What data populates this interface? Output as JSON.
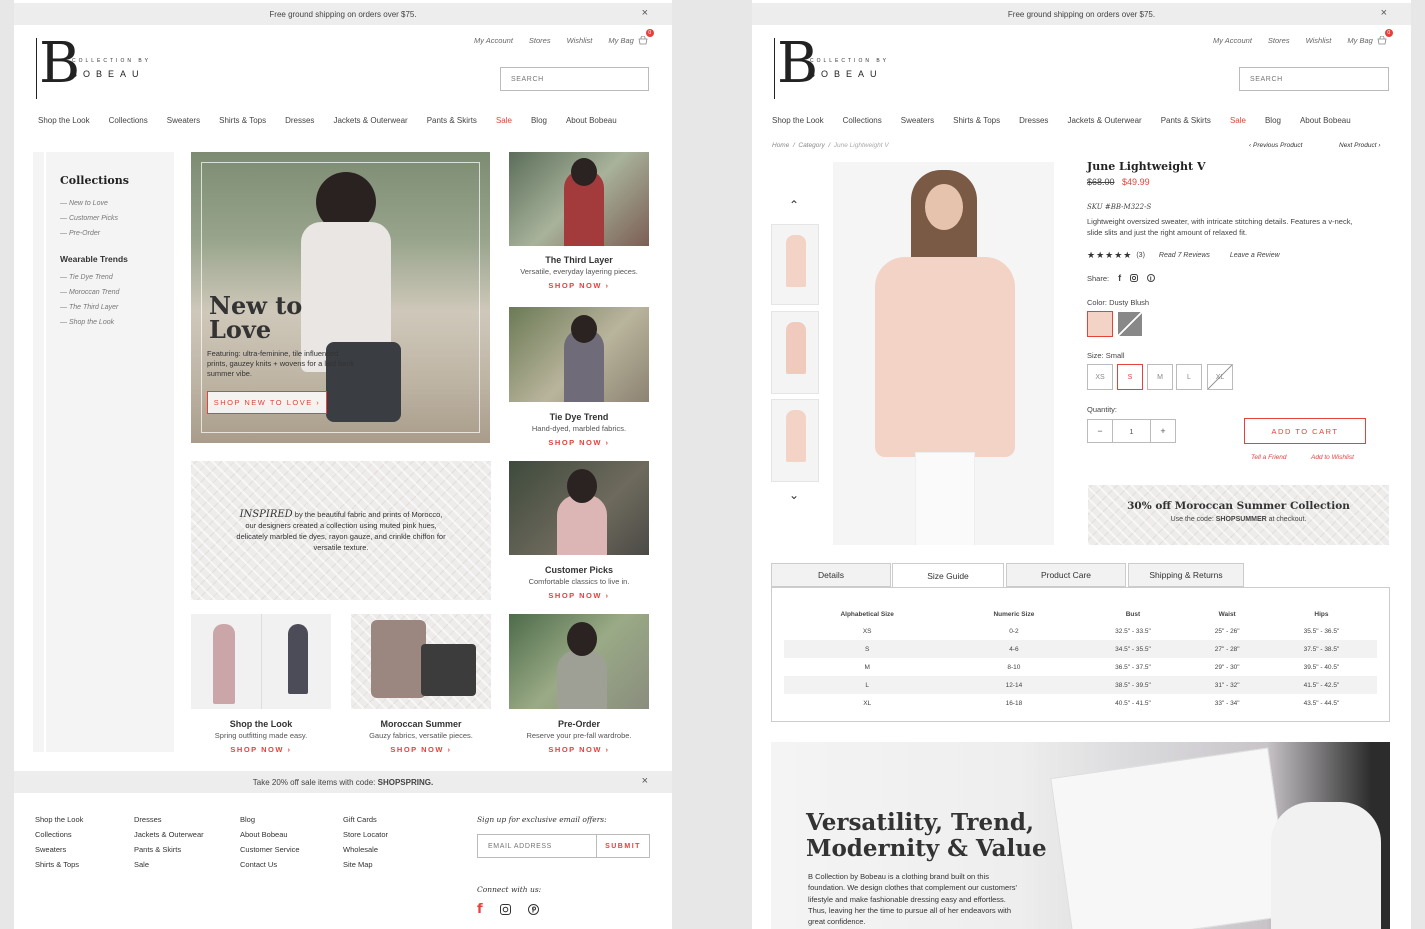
{
  "promo": {
    "text": "Free ground shipping on orders over $75.",
    "close": "×"
  },
  "util": {
    "account": "My Account",
    "stores": "Stores",
    "wishlist": "Wishlist",
    "bag": "My Bag",
    "bag_count": "0"
  },
  "search": {
    "placeholder": "SEARCH"
  },
  "logo": {
    "letter": "B",
    "sub": "COLLECTION BY",
    "brand": "BOBEAU"
  },
  "nav": [
    "Shop the Look",
    "Collections",
    "Sweaters",
    "Shirts & Tops",
    "Dresses",
    "Jackets & Outerwear",
    "Pants & Skirts",
    "Sale",
    "Blog",
    "About Bobeau"
  ],
  "sidebar": {
    "title": "Collections",
    "items": [
      "New to Love",
      "Customer Picks",
      "Pre-Order"
    ],
    "trends_title": "Wearable Trends",
    "trends": [
      "Tie Dye Trend",
      "Moroccan Trend",
      "The Third Layer",
      "Shop the Look"
    ]
  },
  "hero": {
    "title_line1": "New to",
    "title_line2": "Love",
    "desc": "Featuring: ultra-feminine, tile influenced prints, gauzey knits + wovens for a laid back summer vibe.",
    "cta": "SHOP NEW TO LOVE"
  },
  "inspired": {
    "lead": "INSPIRED",
    "text": "by the beautiful fabric and prints of Morocco, our designers created a collection using muted pink hues, delicately marbled tie dyes, rayon gauze, and crinkle chiffon for versatile texture."
  },
  "tiles": [
    {
      "title": "The Third Layer",
      "sub": "Versatile, everyday layering pieces.",
      "cta": "SHOP NOW"
    },
    {
      "title": "Tie Dye Trend",
      "sub": "Hand-dyed, marbled fabrics.",
      "cta": "SHOP NOW"
    },
    {
      "title": "Customer Picks",
      "sub": "Comfortable classics to live in.",
      "cta": "SHOP NOW"
    },
    {
      "title": "Shop the Look",
      "sub": "Spring outfitting made easy.",
      "cta": "SHOP NOW"
    },
    {
      "title": "Moroccan Summer",
      "sub": "Gauzy fabrics, versatile pieces.",
      "cta": "SHOP NOW"
    },
    {
      "title": "Pre-Order",
      "sub": "Reserve your pre-fall wardrobe.",
      "cta": "SHOP NOW"
    }
  ],
  "sale_bar": {
    "text_prefix": "Take 20% off sale items with code: ",
    "code": "SHOPSPRING."
  },
  "footer": {
    "col1": [
      "Shop the Look",
      "Collections",
      "Sweaters",
      "Shirts & Tops"
    ],
    "col2": [
      "Dresses",
      "Jackets & Outerwear",
      "Pants & Skirts",
      "Sale"
    ],
    "col3": [
      "Blog",
      "About Bobeau",
      "Customer Service",
      "Contact Us"
    ],
    "col4": [
      "Gift Cards",
      "Store Locator",
      "Wholesale",
      "Site Map"
    ],
    "signup_title": "Sign up for exclusive email offers:",
    "email_placeholder": "EMAIL ADDRESS",
    "submit": "SUBMIT",
    "connect": "Connect with us:"
  },
  "product": {
    "breadcrumb": [
      "Home",
      "Category",
      "June Lightweight V"
    ],
    "prev": "Previous Product",
    "next": "Next Product",
    "name": "June Lightweight V",
    "old_price": "$68.00",
    "price": "$49.99",
    "sku": "SKU #BB-M322-S",
    "desc": "Lightweight oversized sweater, with intricate stitching details. Features a v-neck, slide slits and just the right amount of relaxed fit.",
    "rating": 5,
    "review_count": "(3)",
    "read_reviews": "Read 7 Reviews",
    "leave_review": "Leave a Review",
    "share": "Share:",
    "color_label": "Color: Dusty Blush",
    "size_label": "Size: Small",
    "sizes": [
      "XS",
      "S",
      "M",
      "L",
      "XL"
    ],
    "quantity_label": "Quantity:",
    "quantity": "1",
    "add_to_cart": "ADD TO CART",
    "tell_friend": "Tell a Friend",
    "add_wishlist": "Add to Wishlist",
    "promo_title": "30% off Moroccan Summer Collection",
    "promo_prefix": "Use the code: ",
    "promo_code": "SHOPSUMMER",
    "promo_suffix": " at checkout."
  },
  "tabs": [
    "Details",
    "Size Guide",
    "Product Care",
    "Shipping & Returns"
  ],
  "size_table": {
    "headers": [
      "Alphabetical Size",
      "Numeric Size",
      "Bust",
      "Waist",
      "Hips"
    ],
    "rows": [
      [
        "XS",
        "0-2",
        "32.5\" - 33.5\"",
        "25\" - 26\"",
        "35.5\" - 36.5\""
      ],
      [
        "S",
        "4-6",
        "34.5\" - 35.5\"",
        "27\" - 28\"",
        "37.5\" - 38.5\""
      ],
      [
        "M",
        "8-10",
        "36.5\" - 37.5\"",
        "29\" - 30\"",
        "39.5\" - 40.5\""
      ],
      [
        "L",
        "12-14",
        "38.5\" - 39.5\"",
        "31\" - 32\"",
        "41.5\" - 42.5\""
      ],
      [
        "XL",
        "16-18",
        "40.5\" - 41.5\"",
        "33\" - 34\"",
        "43.5\" - 44.5\""
      ]
    ]
  },
  "banner": {
    "title_line1": "Versatility, Trend,",
    "title_line2": "Modernity & Value",
    "text": "B Collection by Bobeau is a clothing brand built on this foundation. We design clothes that complement our customers' lifestyle and make fashionable dressing easy and effortless. Thus, leaving her the time to pursue all of her endeavors with great confidence."
  },
  "colors": {
    "accent": "#e5423c",
    "swatch_blush": "#f3d3c5"
  }
}
